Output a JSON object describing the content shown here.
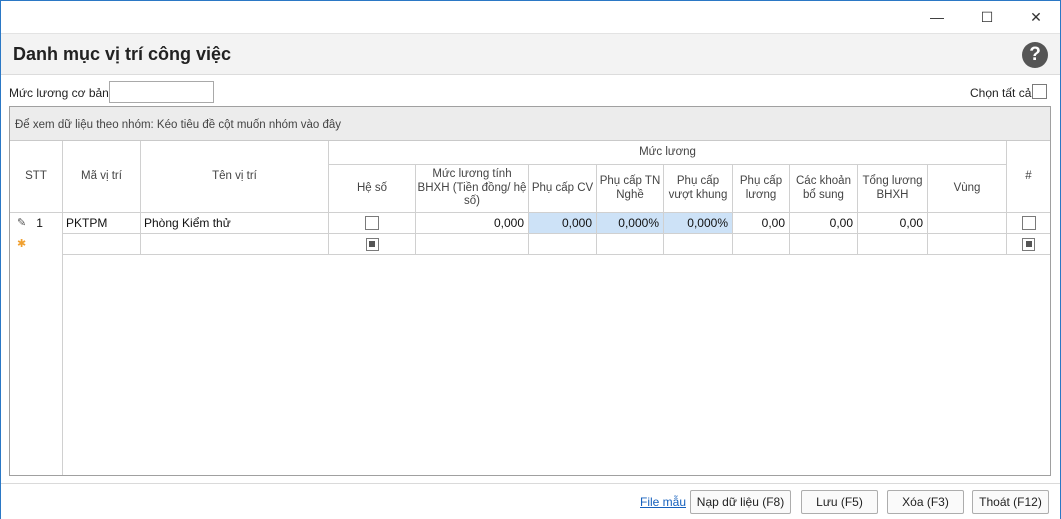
{
  "window_controls": {
    "minimize": "—",
    "maximize": "☐",
    "close": "✕"
  },
  "form_title": "Danh mục vị trí công việc",
  "help_glyph": "?",
  "basic_salary": {
    "label": "Mức lương cơ bản:",
    "value": ""
  },
  "select_all_label": "Chọn tất cả",
  "group_panel_text": "Để xem dữ liệu theo nhóm: Kéo tiêu đề cột muốn nhóm vào đây",
  "columns": {
    "stt": "STT",
    "code": "Mã vị trí",
    "name": "Tên vị trí",
    "salary_group": "Mức lương",
    "coef": "Hệ số",
    "bhxh_salary": "Mức lương tính BHXH (Tiền đồng/ hệ số)",
    "pos_allowance": "Phụ cấp CV",
    "tn_allowance": "Phụ cấp TN Nghề",
    "over_allowance": "Phụ cấp vượt khung",
    "salary_allowance": "Phụ cấp lương",
    "extras": "Các khoản bổ sung",
    "total_bhxh": "Tổng lương BHXH",
    "region": "Vùng",
    "hash": "#"
  },
  "rows": [
    {
      "indicator": "✎",
      "stt": "1",
      "code": "PKTPM",
      "name": "Phòng Kiểm thử",
      "bhxh_salary": "0,000",
      "pos_allowance": "0,000",
      "tn_allowance": "0,000%",
      "over_allowance": "0,000%",
      "salary_allowance": "0,00",
      "extras": "0,00",
      "total_bhxh": "0,00",
      "region": ""
    }
  ],
  "new_row_indicator": "✱",
  "footer": {
    "template_link": "File mẫu",
    "load_button": "Nạp dữ liệu (F8)",
    "save_button": "Lưu (F5)",
    "delete_button": "Xóa (F3)",
    "exit_button": "Thoát (F12)"
  },
  "colors": {
    "accent": "#2b78c5",
    "selected_cell": "#cde2f7",
    "link": "#1560bd"
  }
}
